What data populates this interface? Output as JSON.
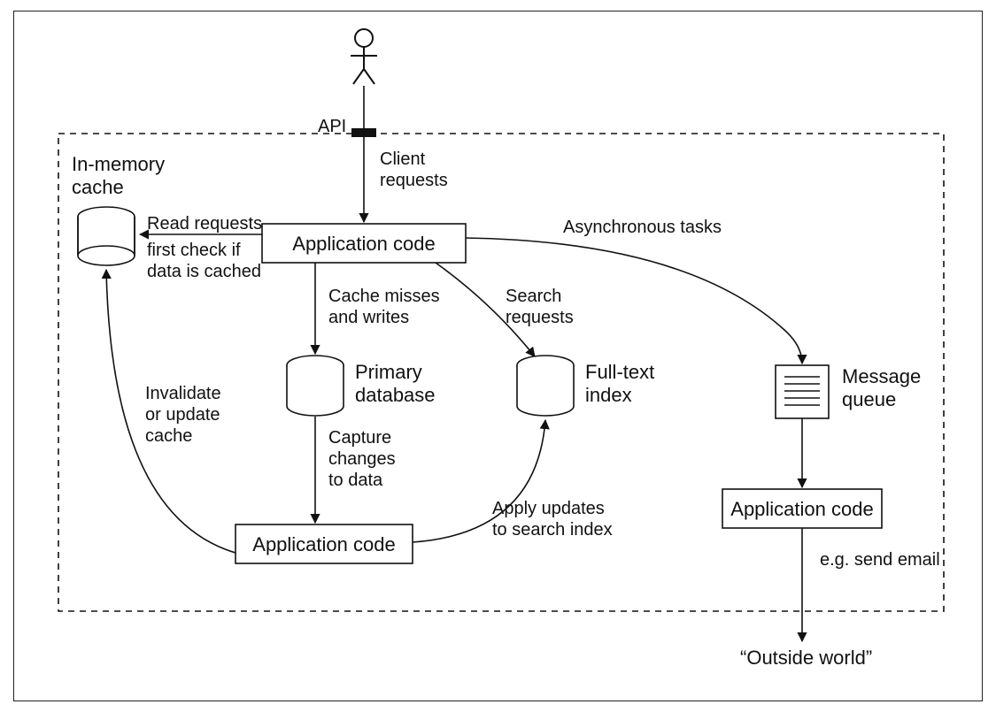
{
  "diagram": {
    "system_boundary": "dashed",
    "actor": "user",
    "api_label": "API",
    "nodes": {
      "cache": {
        "type": "cylinder",
        "label": "In-memory\ncache"
      },
      "app_top": {
        "type": "box",
        "label": "Application code"
      },
      "primary_db": {
        "type": "cylinder",
        "label": "Primary\ndatabase"
      },
      "ft_index": {
        "type": "cylinder",
        "label": "Full-text\nindex"
      },
      "mq": {
        "type": "queue",
        "label": "Message\nqueue"
      },
      "app_mid": {
        "type": "box",
        "label": "Application code"
      },
      "app_right": {
        "type": "box",
        "label": "Application code"
      },
      "outside": {
        "type": "text",
        "label": "“Outside world”"
      }
    },
    "edges": {
      "client_requests": {
        "from": "actor",
        "to": "app_top",
        "label": "Client\nrequests"
      },
      "read_requests": {
        "from": "app_top",
        "to": "cache",
        "label": "Read requests"
      },
      "read_requests_note": "first check if\ndata is cached",
      "cache_misses": {
        "from": "app_top",
        "to": "primary_db",
        "label": "Cache misses\nand writes"
      },
      "search_requests": {
        "from": "app_top",
        "to": "ft_index",
        "label": "Search\nrequests"
      },
      "async_tasks": {
        "from": "app_top",
        "to": "mq",
        "label": "Asynchronous tasks"
      },
      "capture_changes": {
        "from": "primary_db",
        "to": "app_mid",
        "label": "Capture\nchanges\nto data"
      },
      "apply_updates": {
        "from": "app_mid",
        "to": "ft_index",
        "label": "Apply updates\nto search index"
      },
      "invalidate_cache": {
        "from": "app_mid",
        "to": "cache",
        "label": "Invalidate\nor update\ncache"
      },
      "mq_to_app": {
        "from": "mq",
        "to": "app_right",
        "label": ""
      },
      "send_email": {
        "from": "app_right",
        "to": "outside",
        "label": "e.g. send email"
      }
    }
  }
}
